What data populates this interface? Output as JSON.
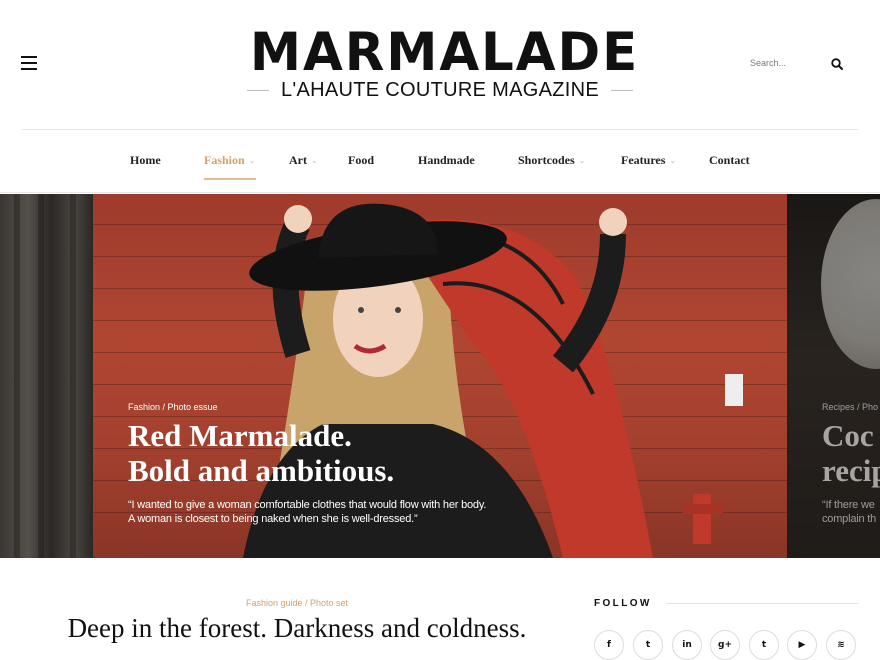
{
  "header": {
    "logo_title": "MARMALADE",
    "logo_subtitle": "L'AHAUTE COUTURE MAGAZINE",
    "menu_icon": "hamburger-icon",
    "search": {
      "placeholder": "Search...",
      "icon": "search-icon"
    }
  },
  "nav": {
    "items": [
      {
        "label": "Home",
        "has_submenu": false,
        "active": false
      },
      {
        "label": "Fashion",
        "has_submenu": true,
        "active": true
      },
      {
        "label": "Art",
        "has_submenu": true,
        "active": false
      },
      {
        "label": "Food",
        "has_submenu": false,
        "active": false
      },
      {
        "label": "Handmade",
        "has_submenu": false,
        "active": false
      },
      {
        "label": "Shortcodes",
        "has_submenu": true,
        "active": false
      },
      {
        "label": "Features",
        "has_submenu": true,
        "active": false
      },
      {
        "label": "Contact",
        "has_submenu": false,
        "active": false
      }
    ],
    "chevron": "⌄"
  },
  "slider": {
    "current": {
      "category": "Fashion / Photo essue",
      "title_line1": "Red Marmalade.",
      "title_line2": "Bold and ambitious.",
      "quote_line1": "“I wanted to give a woman comfortable clothes that would flow with her body.",
      "quote_line2": "A woman is closest to being naked when she is well-dressed.”"
    },
    "next": {
      "category": "Recipes / Pho",
      "title_line1": "Coc",
      "title_line2": "recip",
      "quote_line1": "“If there we",
      "quote_line2": "complain th"
    }
  },
  "post": {
    "category": "Fashion guide / Photo set",
    "title": "Deep in the forest. Darkness and coldness."
  },
  "follow": {
    "title": "FOLLOW",
    "networks": [
      {
        "icon": "facebook-icon",
        "glyph": "f"
      },
      {
        "icon": "twitter-icon",
        "glyph": "t"
      },
      {
        "icon": "linkedin-icon",
        "glyph": "in"
      },
      {
        "icon": "google-plus-icon",
        "glyph": "g+"
      },
      {
        "icon": "tumblr-icon",
        "glyph": "t"
      },
      {
        "icon": "youtube-icon",
        "glyph": "▶"
      },
      {
        "icon": "rss-icon",
        "glyph": "≋"
      }
    ]
  },
  "colors": {
    "accent": "#d4a06c",
    "text": "#111111",
    "divider": "#e8e8e8"
  }
}
